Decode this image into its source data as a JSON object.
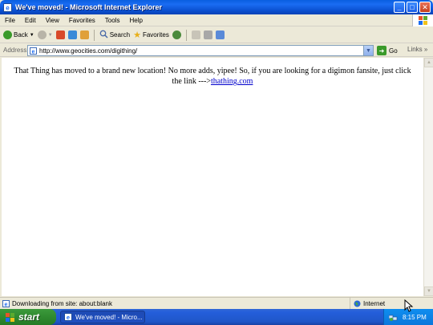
{
  "window": {
    "title": "We've moved! - Microsoft Internet Explorer",
    "icon": "ie-icon",
    "controls": [
      "minimize",
      "maximize",
      "close"
    ]
  },
  "menu": {
    "items": [
      "File",
      "Edit",
      "View",
      "Favorites",
      "Tools",
      "Help"
    ]
  },
  "toolbar": {
    "back_label": "Back",
    "search_label": "Search",
    "favorites_label": "Favorites"
  },
  "address": {
    "label": "Address",
    "value": "http://www.geocities.com/digithing/",
    "go_label": "Go",
    "links_label": "Links"
  },
  "content": {
    "message": "That Thing has moved to a brand new location! No more adds, yipee! So, if you are looking for a digimon fansite, just click the link --->",
    "link_text": "thathing.com"
  },
  "status": {
    "text": "Downloading from site: about:blank",
    "zone": "Internet"
  },
  "taskbar": {
    "start_label": "start",
    "task_label": "We've moved! - Micro...",
    "clock": "8:15 PM"
  },
  "colors": {
    "titlebar": "#0a5fe0",
    "taskbar": "#245edb",
    "start": "#2f8a2f",
    "link": "#0000cc"
  }
}
